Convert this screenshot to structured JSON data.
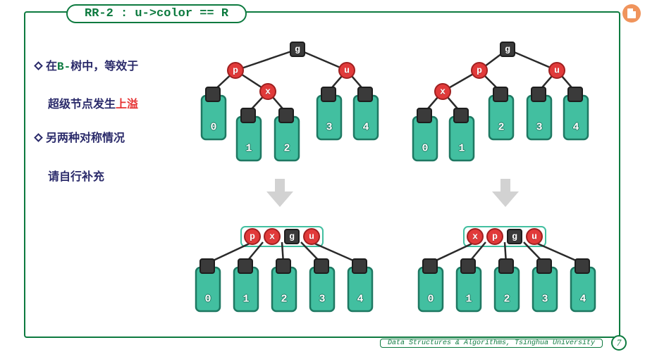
{
  "title": "RR-2 : u->color == R",
  "bullets": {
    "b1_main": "在",
    "b1_code": "B-",
    "b1_rest": "树中，等效于",
    "b1_sub_pre": "超级节点发生",
    "b1_sub_red": "上溢",
    "b2": "另两种对称情况",
    "b2_sub": "请自行补充"
  },
  "tree_top_left": {
    "g": "g",
    "p": "p",
    "u": "u",
    "x": "x",
    "leaves": [
      "0",
      "1",
      "2",
      "3",
      "4"
    ]
  },
  "tree_top_right": {
    "g": "g",
    "p": "p",
    "u": "u",
    "x": "x",
    "leaves": [
      "0",
      "1",
      "2",
      "3",
      "4"
    ]
  },
  "tree_bot_left": {
    "cluster": [
      "p",
      "x",
      "g",
      "u"
    ],
    "leaves": [
      "0",
      "1",
      "2",
      "3",
      "4"
    ]
  },
  "tree_bot_right": {
    "cluster": [
      "x",
      "p",
      "g",
      "u"
    ],
    "leaves": [
      "0",
      "1",
      "2",
      "3",
      "4"
    ]
  },
  "footer": "Data Structures & Algorithms, Tsinghua University",
  "page": "7"
}
